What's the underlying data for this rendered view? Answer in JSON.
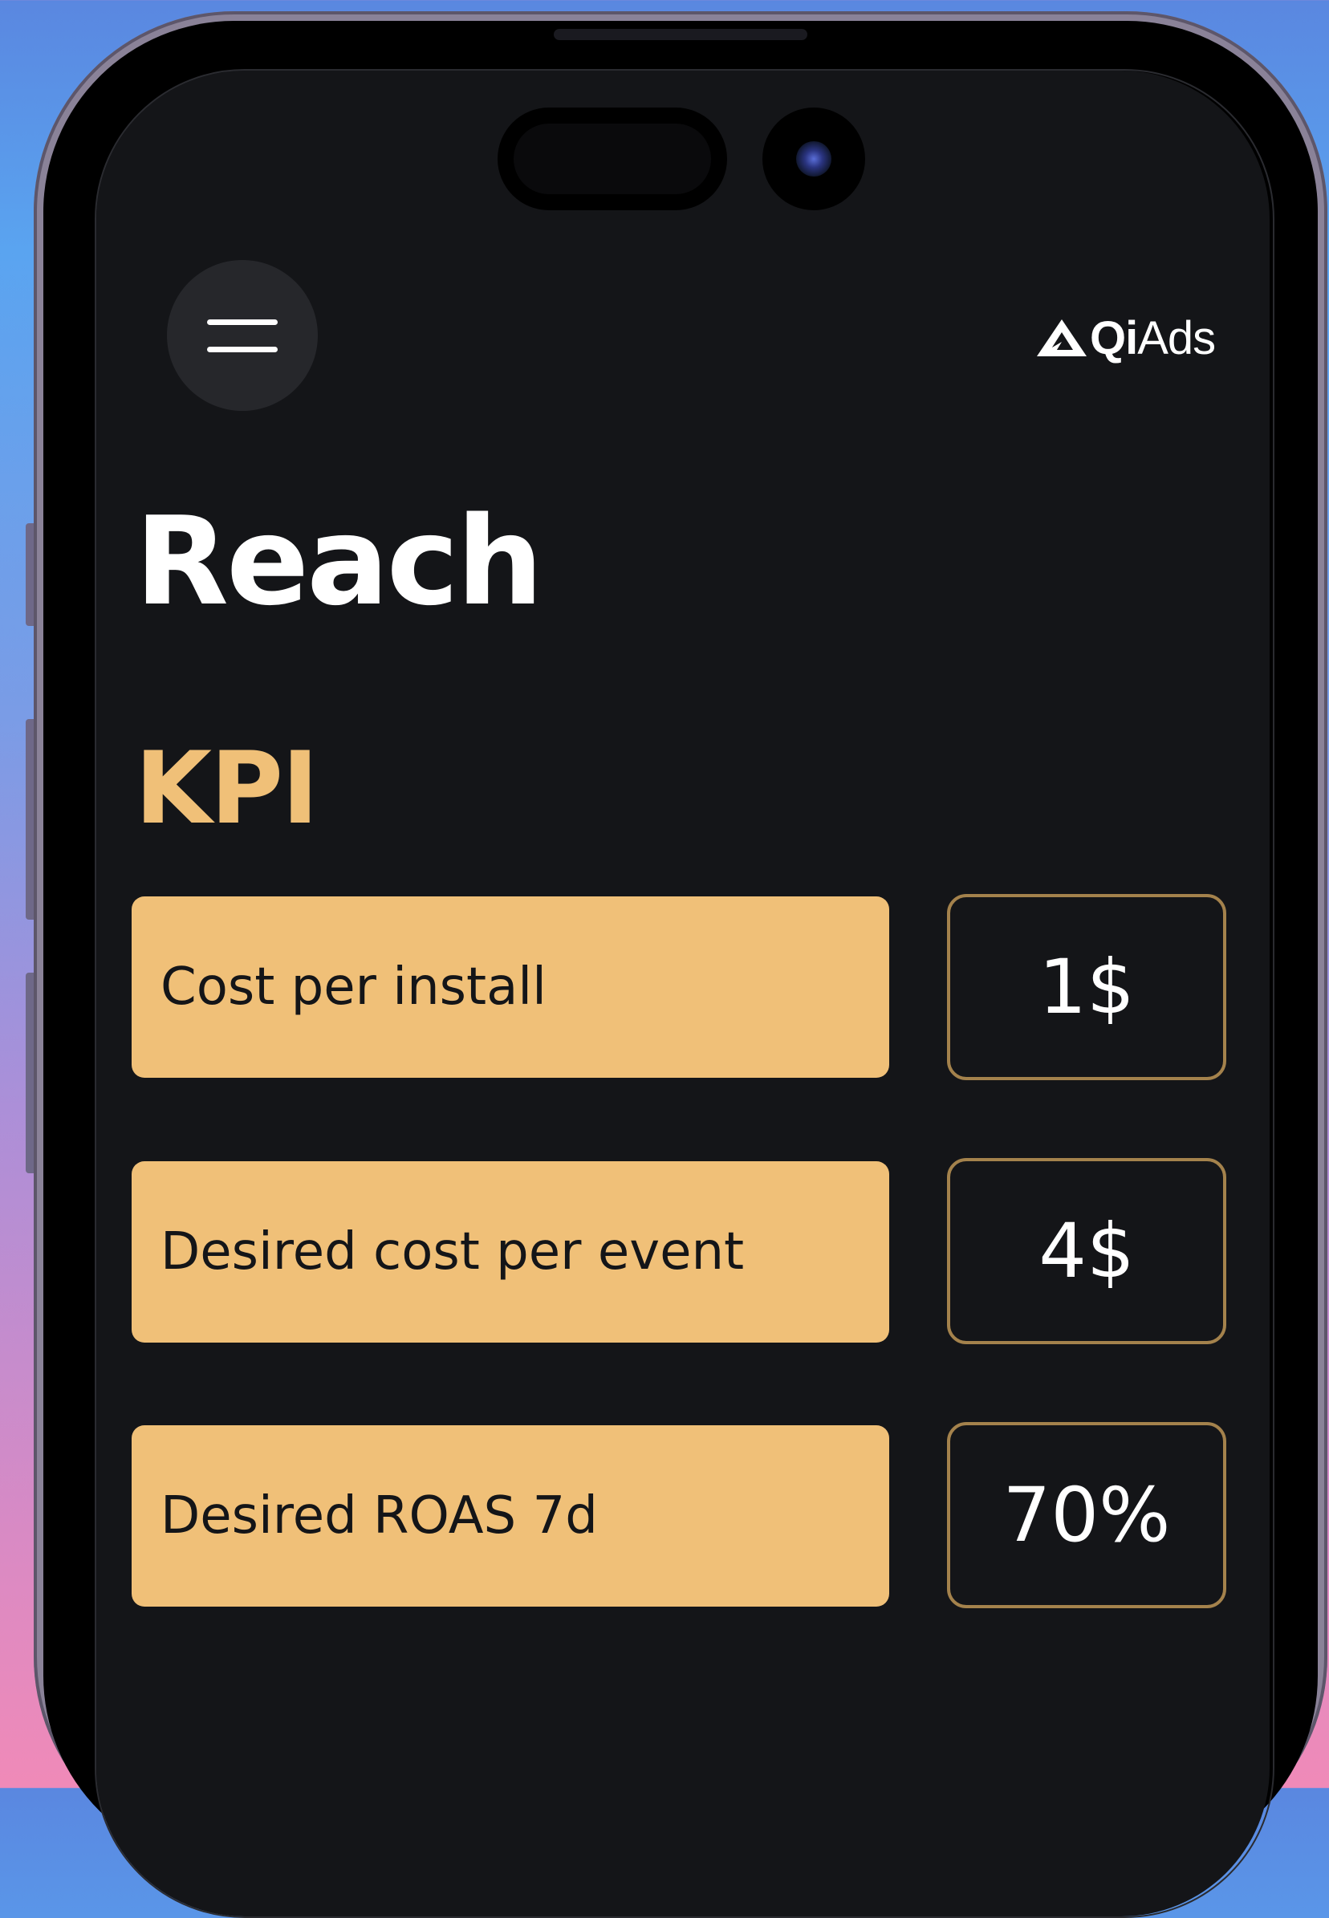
{
  "header": {
    "menu_icon": "hamburger-menu-icon",
    "logo": {
      "mark_icon": "triangle-logo-icon",
      "text_bold": "Qi",
      "text_light": "Ads"
    }
  },
  "page": {
    "title": "Reach"
  },
  "kpi": {
    "section_title": "KPI",
    "rows": [
      {
        "label": "Cost per install",
        "value": "1$"
      },
      {
        "label": "Desired cost per event",
        "value": "4$"
      },
      {
        "label": "Desired ROAS 7d",
        "value": "70%"
      }
    ]
  },
  "colors": {
    "background": "#141518",
    "accent": "#f0c078",
    "value_border": "#a4824c",
    "text": "#ffffff"
  }
}
